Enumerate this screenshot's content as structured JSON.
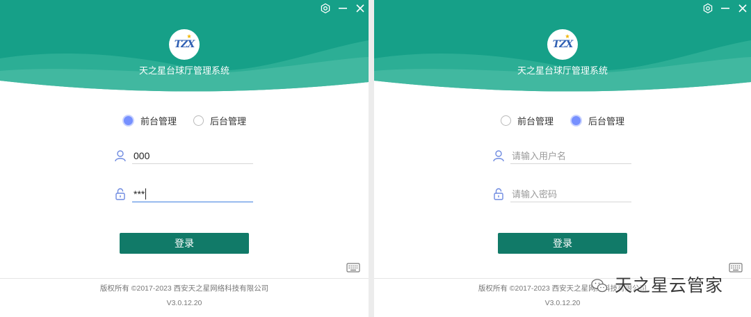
{
  "colors": {
    "header": "#16a088",
    "header_wave_light": "#3cb79e",
    "header_wave_lighter": "#5cc5ad",
    "button": "#117a68",
    "radio_selected": "#7690ff",
    "icon_blue": "#6e8ae0",
    "focus_underline": "#3c7de0"
  },
  "icons": {
    "settings": "gear-icon",
    "minimize": "minimize-icon",
    "close": "close-icon",
    "user": "user-icon",
    "lock": "lock-icon",
    "keyboard": "keyboard-icon"
  },
  "windows": [
    {
      "logo_text": "TZX",
      "title": "天之星台球厅管理系统",
      "modes": [
        {
          "label": "前台管理",
          "selected": true
        },
        {
          "label": "后台管理",
          "selected": false
        }
      ],
      "username": {
        "value": "000"
      },
      "password": {
        "value": "***",
        "focused": true
      },
      "login_label": "登录",
      "copyright": "版权所有 ©2017-2023 西安天之星网络科技有限公司",
      "version": "V3.0.12.20"
    },
    {
      "logo_text": "TZX",
      "title": "天之星台球厅管理系统",
      "modes": [
        {
          "label": "前台管理",
          "selected": false
        },
        {
          "label": "后台管理",
          "selected": true
        }
      ],
      "username": {
        "placeholder": "请输入用户名"
      },
      "password": {
        "placeholder": "请输入密码",
        "focused": false
      },
      "login_label": "登录",
      "copyright": "版权所有 ©2017-2023 西安天之星网络科技有限公司",
      "version": "V3.0.12.20"
    }
  ],
  "watermark": {
    "text": "天之星云管家",
    "icon": "wechat-icon"
  }
}
